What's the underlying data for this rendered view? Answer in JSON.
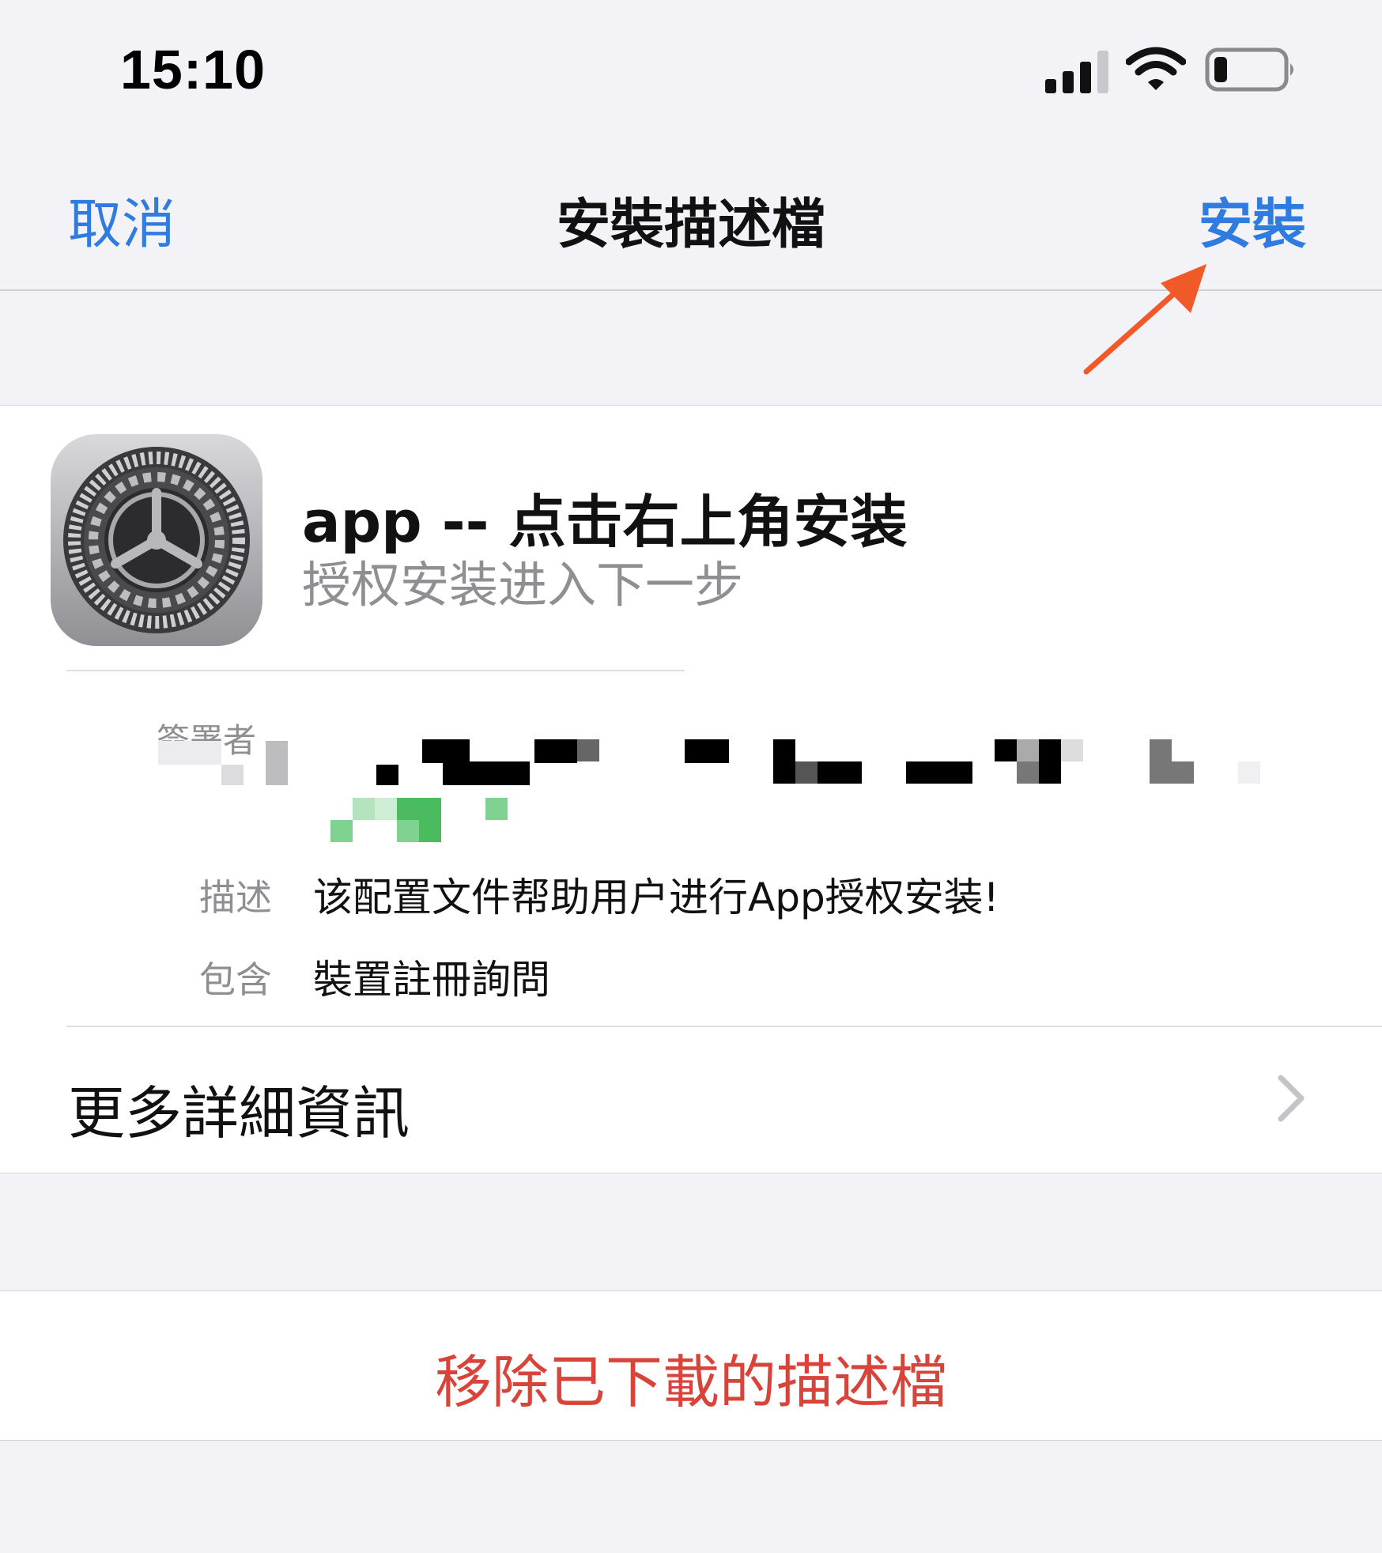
{
  "status_bar": {
    "time": "15:10",
    "icons": [
      "cellular-signal-icon",
      "wifi-icon",
      "battery-icon"
    ]
  },
  "nav": {
    "cancel_label": "取消",
    "title": "安裝描述檔",
    "install_label": "安裝"
  },
  "profile": {
    "name": "app -- 点击右上角安装",
    "subtitle": "授权安装进入下一步",
    "icon": "settings-gear-icon",
    "signer_label": "簽署者",
    "description_label": "描述",
    "description_value": "该配置文件帮助用户进行App授权安装!",
    "contains_label": "包含",
    "contains_value": "裝置註冊詢問"
  },
  "more_info": {
    "label": "更多詳細資訊"
  },
  "remove": {
    "label": "移除已下載的描述檔"
  },
  "colors": {
    "accent": "#2f7be0",
    "destructive": "#d9443a",
    "annotation_arrow": "#f05a28",
    "background": "#f2f2f7"
  }
}
